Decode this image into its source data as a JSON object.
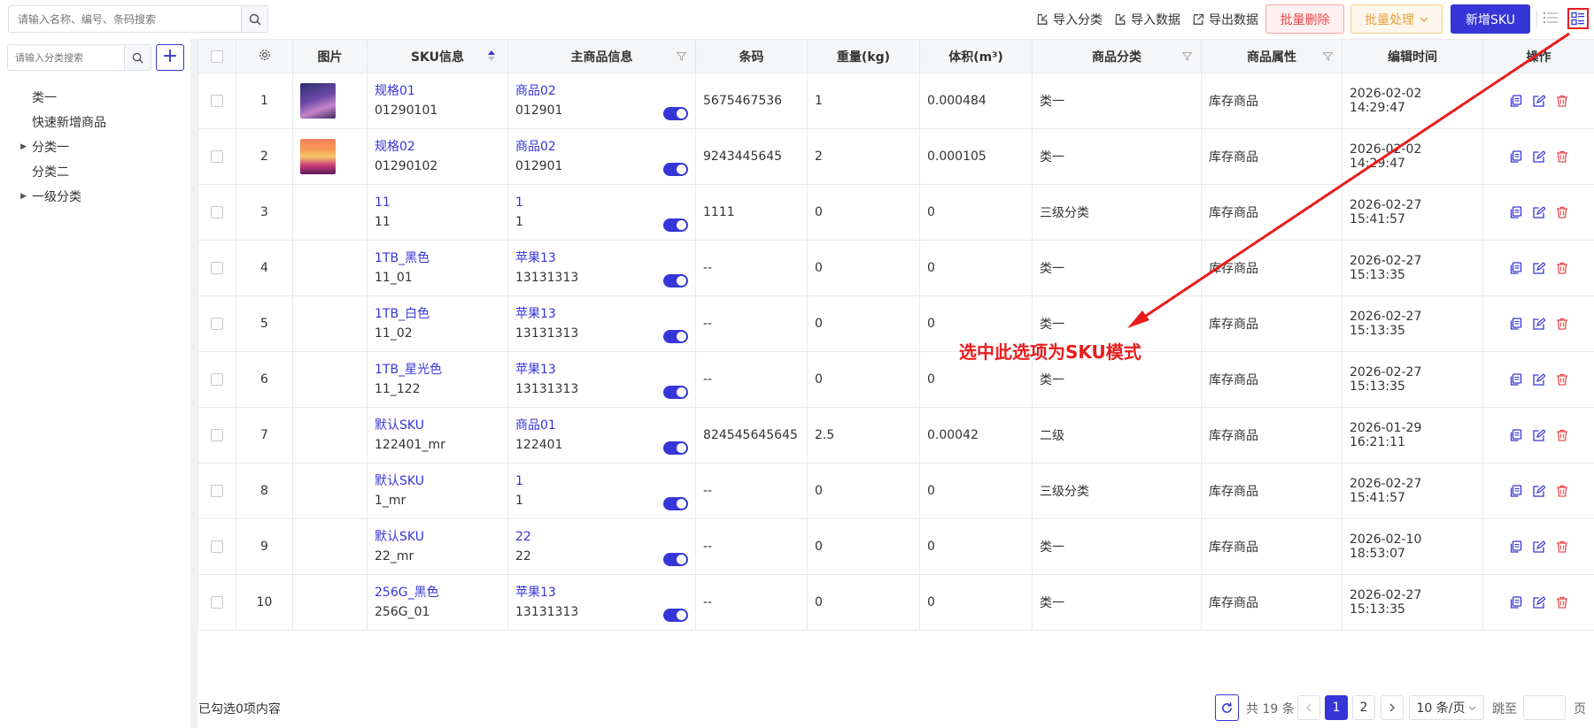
{
  "toolbar": {
    "search_placeholder": "请输入名称、编号、条码搜索",
    "import_category": "导入分类",
    "import_data": "导入数据",
    "export_data": "导出数据",
    "batch_delete": "批量删除",
    "batch_process": "批量处理",
    "new_sku": "新增SKU"
  },
  "sidebar": {
    "search_placeholder": "请输入分类搜索",
    "add_label": "+",
    "items": [
      {
        "label": "类一",
        "expandable": false
      },
      {
        "label": "快速新增商品",
        "expandable": false
      },
      {
        "label": "分类一",
        "expandable": true
      },
      {
        "label": "分类二",
        "expandable": false
      },
      {
        "label": "一级分类",
        "expandable": true
      }
    ]
  },
  "table": {
    "columns": {
      "image": "图片",
      "sku": "SKU信息",
      "main": "主商品信息",
      "barcode": "条码",
      "weight": "重量(kg)",
      "volume": "体积(m³)",
      "category": "商品分类",
      "attribute": "商品属性",
      "edit_time": "编辑时间",
      "ops": "操作"
    },
    "rows": [
      {
        "no": "1",
        "thumb": "thumb1",
        "sku_name": "规格01",
        "sku_code": "01290101",
        "main_name": "商品02",
        "main_code": "012901",
        "barcode": "5675467536",
        "weight": "1",
        "volume": "0.000484",
        "category": "类一",
        "attribute": "库存商品",
        "edit_time": "2026-02-02 14:29:47"
      },
      {
        "no": "2",
        "thumb": "thumb2",
        "sku_name": "规格02",
        "sku_code": "01290102",
        "main_name": "商品02",
        "main_code": "012901",
        "barcode": "9243445645",
        "weight": "2",
        "volume": "0.000105",
        "category": "类一",
        "attribute": "库存商品",
        "edit_time": "2026-02-02 14:29:47"
      },
      {
        "no": "3",
        "thumb": "",
        "sku_name": "11",
        "sku_code": "11",
        "main_name": "1",
        "main_code": "1",
        "barcode": "1111",
        "weight": "0",
        "volume": "0",
        "category": "三级分类",
        "attribute": "库存商品",
        "edit_time": "2026-02-27 15:41:57"
      },
      {
        "no": "4",
        "thumb": "",
        "sku_name": "1TB_黑色",
        "sku_code": "11_01",
        "main_name": "苹果13",
        "main_code": "13131313",
        "barcode": "--",
        "weight": "0",
        "volume": "0",
        "category": "类一",
        "attribute": "库存商品",
        "edit_time": "2026-02-27 15:13:35"
      },
      {
        "no": "5",
        "thumb": "",
        "sku_name": "1TB_白色",
        "sku_code": "11_02",
        "main_name": "苹果13",
        "main_code": "13131313",
        "barcode": "--",
        "weight": "0",
        "volume": "0",
        "category": "类一",
        "attribute": "库存商品",
        "edit_time": "2026-02-27 15:13:35"
      },
      {
        "no": "6",
        "thumb": "",
        "sku_name": "1TB_星光色",
        "sku_code": "11_122",
        "main_name": "苹果13",
        "main_code": "13131313",
        "barcode": "--",
        "weight": "0",
        "volume": "0",
        "category": "类一",
        "attribute": "库存商品",
        "edit_time": "2026-02-27 15:13:35"
      },
      {
        "no": "7",
        "thumb": "",
        "sku_name": "默认SKU",
        "sku_code": "122401_mr",
        "main_name": "商品01",
        "main_code": "122401",
        "barcode": "824545645645",
        "weight": "2.5",
        "volume": "0.00042",
        "category": "二级",
        "attribute": "库存商品",
        "edit_time": "2026-01-29 16:21:11"
      },
      {
        "no": "8",
        "thumb": "",
        "sku_name": "默认SKU",
        "sku_code": "1_mr",
        "main_name": "1",
        "main_code": "1",
        "barcode": "--",
        "weight": "0",
        "volume": "0",
        "category": "三级分类",
        "attribute": "库存商品",
        "edit_time": "2026-02-27 15:41:57"
      },
      {
        "no": "9",
        "thumb": "",
        "sku_name": "默认SKU",
        "sku_code": "22_mr",
        "main_name": "22",
        "main_code": "22",
        "barcode": "--",
        "weight": "0",
        "volume": "0",
        "category": "类一",
        "attribute": "库存商品",
        "edit_time": "2026-02-10 18:53:07"
      },
      {
        "no": "10",
        "thumb": "",
        "sku_name": "256G_黑色",
        "sku_code": "256G_01",
        "main_name": "苹果13",
        "main_code": "13131313",
        "barcode": "--",
        "weight": "0",
        "volume": "0",
        "category": "类一",
        "attribute": "库存商品",
        "edit_time": "2026-02-27 15:13:35"
      }
    ]
  },
  "footer": {
    "selected_info": "已勾选0项内容",
    "total": "共 19 条",
    "page_1": "1",
    "page_2": "2",
    "page_size": "10 条/页",
    "jump_label": "跳至",
    "page_suffix": "页"
  },
  "annotation": {
    "text": "选中此选项为SKU模式"
  },
  "colors": {
    "primary": "#3535d8",
    "danger": "#f04848",
    "warning": "#e6a23c",
    "annotation": "#e91c1c"
  }
}
